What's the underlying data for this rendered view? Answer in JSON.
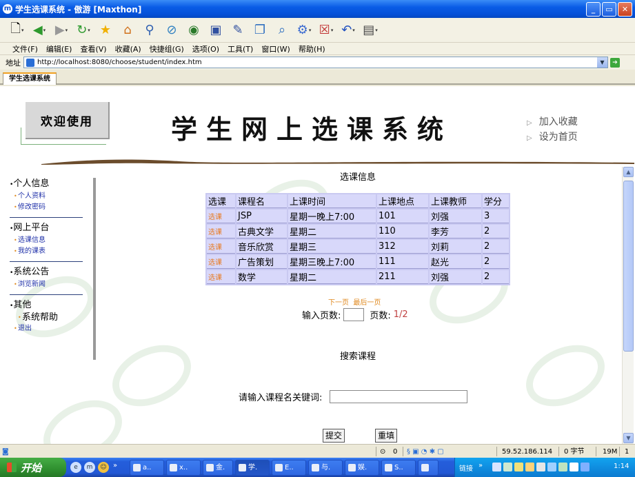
{
  "window": {
    "title": "学生选课系统 - 傲游 [Maxthon]",
    "app_icon": "maxthon-icon",
    "buttons": [
      "_",
      "▭",
      "✕"
    ]
  },
  "toolbar": {
    "icons": [
      "new-page-icon",
      "back-icon",
      "forward-icon",
      "refresh-icon",
      "favorites-star-icon",
      "home-icon",
      "search-icon",
      "stop-icon",
      "globe-icon",
      "save-icon",
      "edit-icon",
      "copy-icon",
      "find-icon",
      "tools-icon",
      "close-tab-icon",
      "undo-icon",
      "options-icon"
    ]
  },
  "menu": {
    "items": [
      "文件(F)",
      "编辑(E)",
      "查看(V)",
      "收藏(A)",
      "快捷组(G)",
      "选项(O)",
      "工具(T)",
      "窗口(W)",
      "帮助(H)"
    ]
  },
  "address": {
    "label": "地址",
    "url": "http://localhost:8080/choose/student/index.htm"
  },
  "tabs": [
    {
      "label": "学生选课系统"
    }
  ],
  "header": {
    "welcome": "欢迎使用",
    "site_title": "学生网上选课系统",
    "links": [
      "加入收藏",
      "设为首页"
    ]
  },
  "nav": {
    "sections": [
      {
        "title": "个人信息",
        "items": [
          "个人资料",
          "修改密码"
        ]
      },
      {
        "title": "网上平台",
        "items": [
          "选课信息",
          "我的课表"
        ]
      },
      {
        "title": "系统公告",
        "items": [
          "浏览新闻"
        ]
      },
      {
        "title": "其他",
        "items": [
          "系统帮助",
          "退出"
        ]
      }
    ]
  },
  "main": {
    "course_section_title": "选课信息",
    "table": {
      "headers": [
        "选课",
        "课程名",
        "上课时间",
        "上课地点",
        "上课教师",
        "学分"
      ],
      "rows": [
        [
          "选课",
          "JSP",
          "星期一晚上7:00",
          "101",
          "刘强",
          "3"
        ],
        [
          "选课",
          "古典文学",
          "星期二",
          "110",
          "李芳",
          "2"
        ],
        [
          "选课",
          "音乐欣赏",
          "星期三",
          "312",
          "刘莉",
          "2"
        ],
        [
          "选课",
          "广告策划",
          "星期三晚上7:00",
          "111",
          "赵光",
          "2"
        ],
        [
          "选课",
          "数学",
          "星期二",
          "211",
          "刘强",
          "2"
        ]
      ]
    },
    "pager": {
      "next": "下一页",
      "last": "最后一页",
      "goto_label": "输入页数:",
      "page_label": "页数:",
      "page_count": "1/2"
    },
    "search": {
      "title": "搜索课程",
      "label": "请输入课程名关键词:",
      "value": "",
      "submit": "提交",
      "reset": "重填"
    }
  },
  "statusbar": {
    "ip": "59.52.186.114",
    "bytes": "0 字节",
    "memory": "19M",
    "count": "1",
    "popup_count": "0"
  },
  "taskbar": {
    "start": "开始",
    "tasks": [
      "a..",
      "x..",
      "金.",
      "学.",
      "E..",
      "与.",
      "娱.",
      "S.."
    ],
    "links_label": "链接",
    "clock": "1:14"
  }
}
